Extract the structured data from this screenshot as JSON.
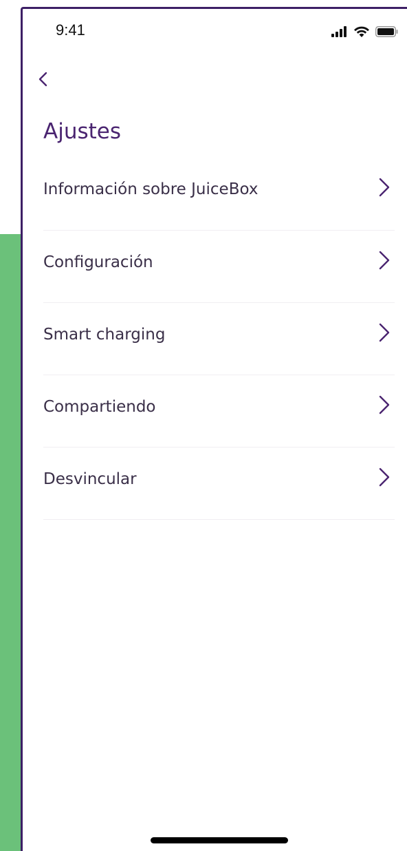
{
  "status_bar": {
    "time": "9:41",
    "icons": [
      "cellular-signal-icon",
      "wifi-icon",
      "battery-icon"
    ]
  },
  "nav": {
    "back_icon": "chevron-left-icon"
  },
  "page": {
    "title": "Ajustes"
  },
  "menu": {
    "items": [
      {
        "label": "Información sobre JuiceBox",
        "icon": "chevron-right-icon"
      },
      {
        "label": "Configuración",
        "icon": "chevron-right-icon"
      },
      {
        "label": "Smart charging",
        "icon": "chevron-right-icon"
      },
      {
        "label": "Compartiendo",
        "icon": "chevron-right-icon"
      },
      {
        "label": "Desvincular",
        "icon": "chevron-right-icon"
      }
    ]
  },
  "colors": {
    "accent": "#4a2470",
    "frame": "#3d1f66",
    "text": "#3a2f48",
    "divider": "#f0eef2",
    "background_strip": "#6bc17a"
  }
}
